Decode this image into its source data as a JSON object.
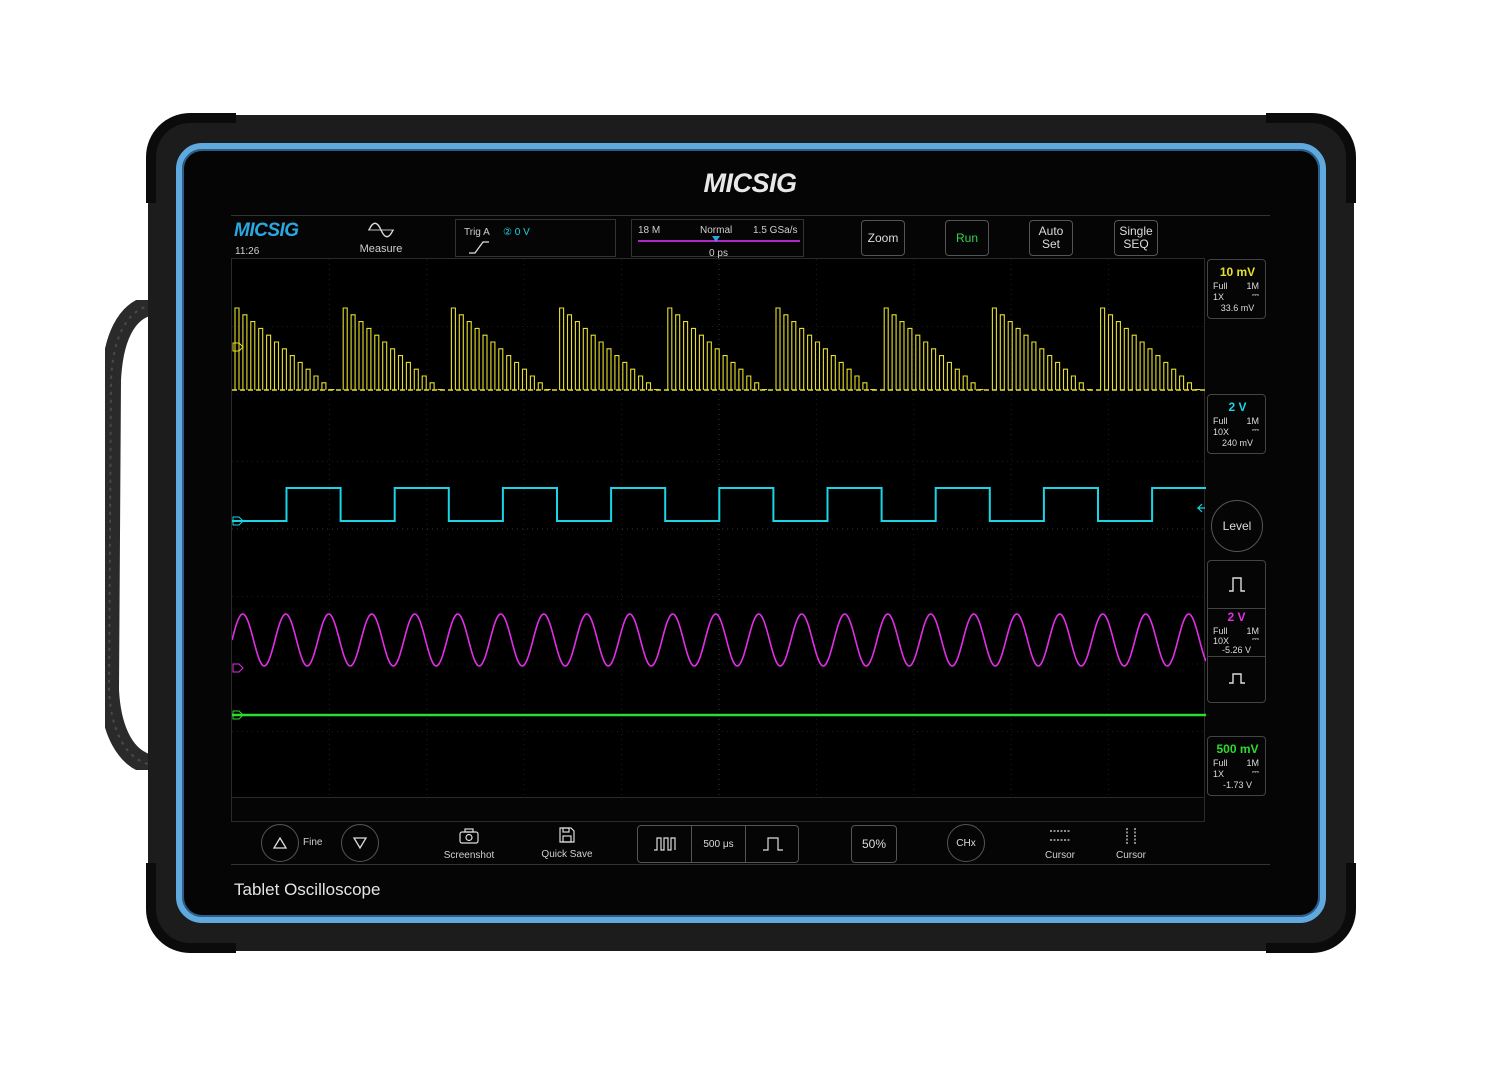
{
  "device": {
    "brand": "MICSIG",
    "model_label": "Tablet Oscilloscope"
  },
  "topbar": {
    "logo": "MICSIG",
    "clock": "11:26",
    "measure_label": "Measure",
    "trigger": {
      "label": "Trig  A",
      "source_level": "② 0 V"
    },
    "timebase": {
      "memory": "18 M",
      "mode": "Normal",
      "sample_rate": "1.5 GSa/s",
      "position": "0 ps"
    },
    "buttons": {
      "zoom": "Zoom",
      "run": "Run",
      "auto_set_1": "Auto",
      "auto_set_2": "Set",
      "single_1": "Single",
      "single_2": "SEQ"
    }
  },
  "channels": [
    {
      "id": "1",
      "scale": "10 mV",
      "bw": "Full",
      "impedance": "1M",
      "probe": "1X",
      "offset": "33.6 mV",
      "color": "#e6e02a"
    },
    {
      "id": "2",
      "scale": "2 V",
      "bw": "Full",
      "impedance": "1M",
      "probe": "10X",
      "offset": "240 mV",
      "color": "#19d5e6"
    },
    {
      "id": "3",
      "scale": "2 V",
      "bw": "Full",
      "impedance": "1M",
      "probe": "10X",
      "offset": "-5.26 V",
      "color": "#e22ee8"
    },
    {
      "id": "4",
      "scale": "500 mV",
      "bw": "Full",
      "impedance": "1M",
      "probe": "1X",
      "offset": "-1.73 V",
      "color": "#2edb2e"
    }
  ],
  "right_panel": {
    "level_label": "Level"
  },
  "bottombar": {
    "fine_label": "Fine",
    "screenshot_label": "Screenshot",
    "quick_save_label": "Quick Save",
    "timebase_value": "500 μs",
    "fifty_percent": "50%",
    "chx_label": "CHx",
    "cursor_h_label": "Cursor",
    "cursor_v_label": "Cursor"
  },
  "icons": [
    "sine-wave-icon",
    "rising-edge-icon",
    "camera-icon",
    "floppy-save-icon",
    "pulse-train-icon",
    "single-pulse-icon",
    "triangle-up-icon",
    "triangle-down-icon",
    "horizontal-cursor-icon",
    "vertical-cursor-icon"
  ]
}
